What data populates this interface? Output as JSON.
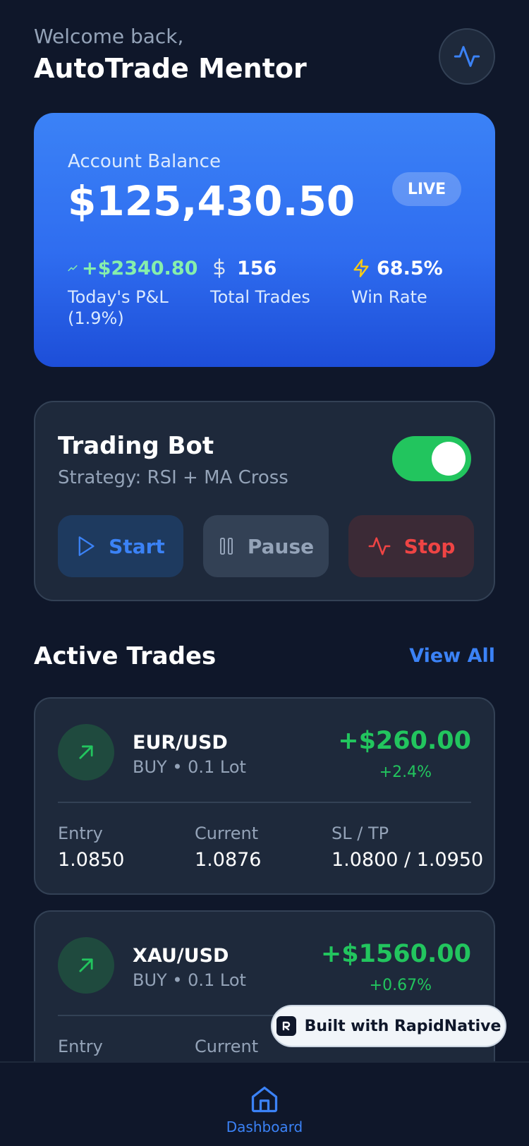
{
  "header": {
    "welcome": "Welcome back,",
    "title": "AutoTrade Mentor",
    "action_icon": "activity-icon"
  },
  "balance": {
    "label": "Account Balance",
    "value": "$125,430.50",
    "badge": "LIVE",
    "stats": [
      {
        "value": "+$2340.80",
        "label": "Today's P&L (1.9%)",
        "icon": "trending-up-icon"
      },
      {
        "value": "156",
        "label": "Total Trades",
        "icon": "dollar-icon"
      },
      {
        "value": "68.5%",
        "label": "Win Rate",
        "icon": "lightning-icon"
      }
    ]
  },
  "bot": {
    "title": "Trading Bot",
    "strategy": "Strategy: RSI + MA Cross",
    "enabled": true,
    "actions": {
      "start": "Start",
      "pause": "Pause",
      "stop": "Stop"
    }
  },
  "trades": {
    "title": "Active Trades",
    "view_all": "View All",
    "labels": {
      "entry": "Entry",
      "current": "Current",
      "sltp": "SL / TP"
    },
    "items": [
      {
        "pair": "EUR/USD",
        "meta": "BUY • 0.1 Lot",
        "profit": "+$260.00",
        "pct": "+2.4%",
        "entry": "1.0850",
        "current": "1.0876",
        "sltp": "1.0800 / 1.0950"
      },
      {
        "pair": "XAU/USD",
        "meta": "BUY • 0.1 Lot",
        "profit": "+$1560.00",
        "pct": "+0.67%"
      }
    ]
  },
  "badge": {
    "text": "Built with RapidNative"
  },
  "tabbar": {
    "home_label": "Dashboard"
  },
  "colors": {
    "background": "#0f172a",
    "card": "#1e293b",
    "accent": "#3b82f6",
    "positive": "#22c55e",
    "negative": "#ef4444"
  }
}
